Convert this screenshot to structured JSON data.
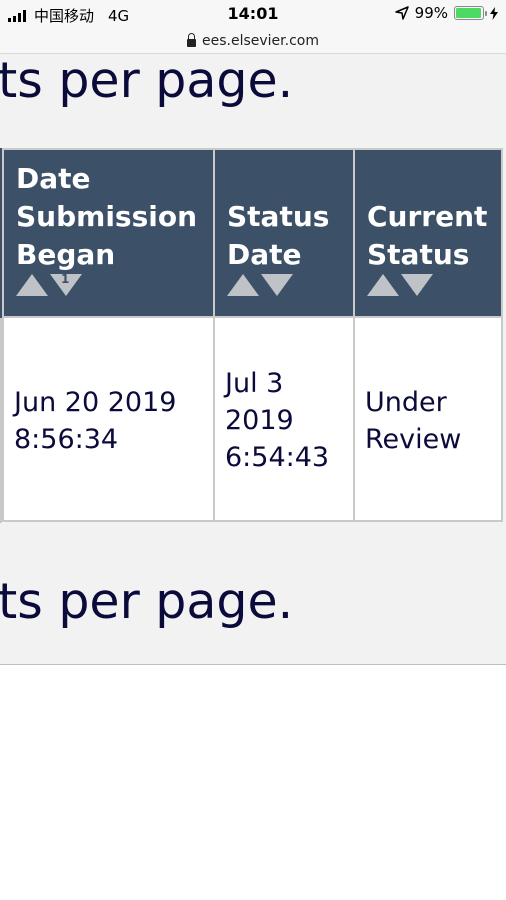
{
  "status_bar": {
    "carrier": "中国移动",
    "network": "4G",
    "time": "14:01",
    "battery": "99%"
  },
  "browser": {
    "url": "ees.elsevier.com"
  },
  "pagination": {
    "top_text": "ts per page.",
    "bottom_text": "ts per page."
  },
  "table": {
    "headers": [
      {
        "label_lines": [
          "Date",
          "Submission",
          "Began"
        ],
        "sort_badge": "1"
      },
      {
        "label_lines": [
          "Status",
          "Date"
        ]
      },
      {
        "label_lines": [
          "Current",
          "Status"
        ]
      }
    ],
    "rows": [
      {
        "date_began": [
          "Jun 20 2019",
          "8:56:34"
        ],
        "status_date": [
          "Jul 3",
          "2019",
          "6:54:43"
        ],
        "current_status": [
          "Under",
          "Review"
        ]
      }
    ]
  },
  "colors": {
    "header_bg": "#3c5167",
    "text": "#0b0b3b",
    "battery": "#4cd964"
  }
}
